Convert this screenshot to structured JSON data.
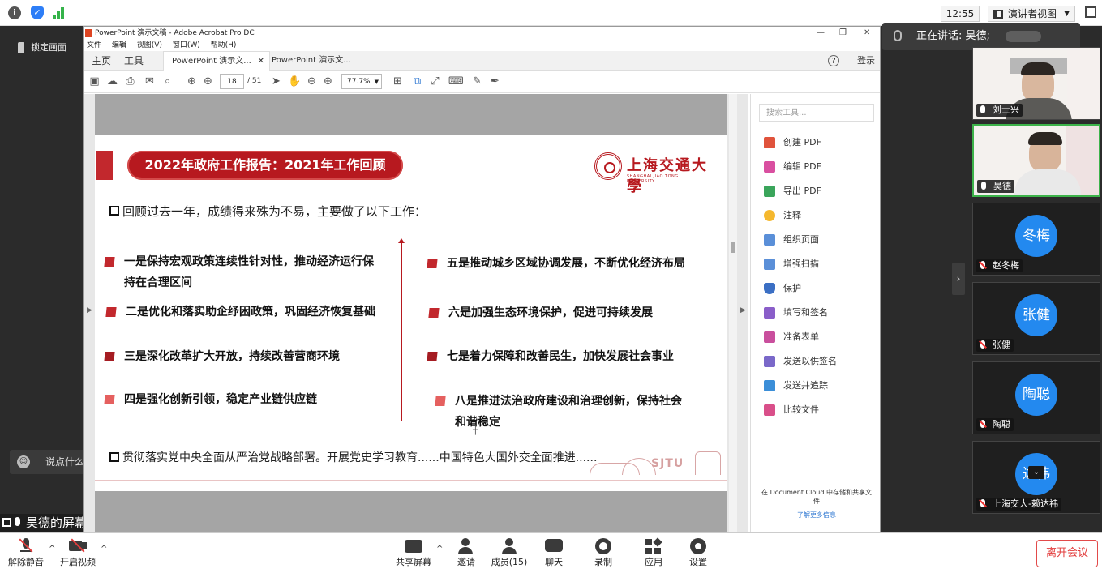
{
  "zoom": {
    "clock": "12:55",
    "presenter_view": "演讲者视图",
    "lock_screen": "锁定画面",
    "chat_placeholder": "说点什么...",
    "share_label": "昊德的屏幕共享",
    "speaking_label": "正在讲话: 昊德;",
    "participants": [
      {
        "name": "刘士兴",
        "type": "video",
        "muted": false
      },
      {
        "name": "昊德",
        "type": "video",
        "muted": false,
        "active": true
      },
      {
        "name": "赵冬梅",
        "type": "avatar",
        "avatar_text": "冬梅",
        "muted": true
      },
      {
        "name": "张健",
        "type": "avatar",
        "avatar_text": "张健",
        "muted": true
      },
      {
        "name": "陶聪",
        "type": "avatar",
        "avatar_text": "陶聪",
        "muted": true
      },
      {
        "name": "上海交大-赖达祎",
        "type": "avatar",
        "avatar_text": "达祎",
        "muted": true
      }
    ],
    "controls": {
      "unmute": "解除静音",
      "start_video": "开启视频",
      "share_screen": "共享屏幕",
      "invite": "邀请",
      "members": "成员(15)",
      "chat": "聊天",
      "record": "录制",
      "apps": "应用",
      "settings": "设置",
      "leave": "离开会议"
    },
    "accent_green": "#3cb34a",
    "avatar_blue": "#2389ef",
    "leave_red": "#e23c3c"
  },
  "acrobat": {
    "window_title": "PowerPoint 演示文稿 - Adobe Acrobat Pro DC",
    "menu": [
      "文件",
      "编辑",
      "视图(V)",
      "窗口(W)",
      "帮助(H)"
    ],
    "nav_tabs": [
      "主页",
      "工具"
    ],
    "doc_tabs": [
      "PowerPoint 演示文...",
      "PowerPoint 演示文..."
    ],
    "login": "登录",
    "page_current": "18",
    "page_total": "/ 51",
    "zoom": "77.7%",
    "tools_search_placeholder": "搜索工具...",
    "tools": [
      {
        "label": "创建 PDF",
        "color": "#e0533c"
      },
      {
        "label": "编辑 PDF",
        "color": "#d94fa0"
      },
      {
        "label": "导出 PDF",
        "color": "#3aa55b"
      },
      {
        "label": "注释",
        "color": "#f5b82e"
      },
      {
        "label": "组织页面",
        "color": "#5a8fd8"
      },
      {
        "label": "增强扫描",
        "color": "#5a8fd8"
      },
      {
        "label": "保护",
        "color": "#3b6fc4"
      },
      {
        "label": "填写和签名",
        "color": "#8a5ec9"
      },
      {
        "label": "准备表单",
        "color": "#c94f9d"
      },
      {
        "label": "发送以供签名",
        "color": "#7a68c9"
      },
      {
        "label": "发送并追踪",
        "color": "#3b8ed8"
      },
      {
        "label": "比较文件",
        "color": "#d94f8a"
      }
    ],
    "cloud_text": "在 Document Cloud 中存储和共享文件",
    "cloud_link": "了解更多信息"
  },
  "slide": {
    "title": "2022年政府工作报告：2021年工作回顾",
    "logo_cn": "上海交通大學",
    "logo_en": "SHANGHAI JIAO TONG UNIVERSITY",
    "intro": "回顾过去一年，成绩得来殊为不易，主要做了以下工作：",
    "left_points": [
      {
        "line1": "一是保持宏观政策连续性针对性，推动经济运行保",
        "line2": "持在合理区间"
      },
      {
        "line1": "二是优化和落实助企纾困政策，巩固经济恢复基础",
        "line2": ""
      },
      {
        "line1": "三是深化改革扩大开放，持续改善营商环境",
        "line2": ""
      },
      {
        "line1": "四是强化创新引领，稳定产业链供应链",
        "line2": ""
      }
    ],
    "right_points": [
      {
        "line1": "五是推动城乡区域协调发展，不断优化经济布局",
        "line2": ""
      },
      {
        "line1": "六是加强生态环境保护，促进可持续发展",
        "line2": ""
      },
      {
        "line1": "七是着力保障和改善民生，加快发展社会事业",
        "line2": ""
      },
      {
        "line1": "八是推进法治政府建设和治理创新，保持社会",
        "line2": "和谐稳定"
      }
    ],
    "footer": "贯彻落实党中央全面从严治党战略部署。开展党史学习教育......中国特色大国外交全面推进......",
    "skyline_text": "SJTU",
    "accent_red": "#b7191f"
  }
}
